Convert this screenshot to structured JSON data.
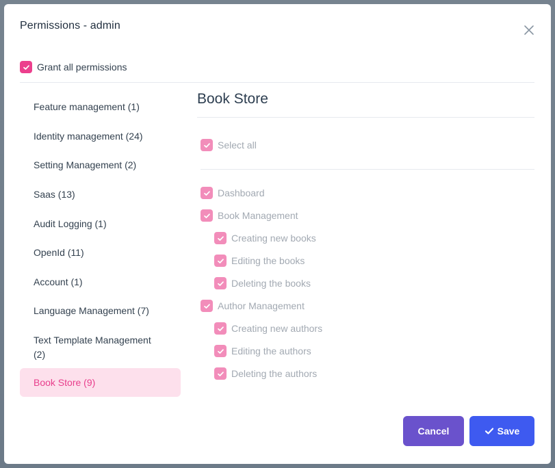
{
  "modal": {
    "title": "Permissions - admin"
  },
  "grant_all": {
    "label": "Grant all permissions",
    "checked": true
  },
  "sidebar": {
    "items": [
      {
        "label": "Feature management (1)"
      },
      {
        "label": "Identity management (24)"
      },
      {
        "label": "Setting Management (2)"
      },
      {
        "label": "Saas (13)"
      },
      {
        "label": "Audit Logging (1)"
      },
      {
        "label": "OpenId (11)"
      },
      {
        "label": "Account (1)"
      },
      {
        "label": "Language Management (7)"
      },
      {
        "label": "Text Template Management (2)"
      },
      {
        "label": "Book Store (9)",
        "active": true
      }
    ]
  },
  "panel": {
    "title": "Book Store",
    "select_all": "Select all",
    "permissions": [
      {
        "label": "Dashboard",
        "level": 0,
        "checked": true
      },
      {
        "label": "Book Management",
        "level": 0,
        "checked": true
      },
      {
        "label": "Creating new books",
        "level": 1,
        "checked": true
      },
      {
        "label": "Editing the books",
        "level": 1,
        "checked": true
      },
      {
        "label": "Deleting the books",
        "level": 1,
        "checked": true
      },
      {
        "label": "Author Management",
        "level": 0,
        "checked": true
      },
      {
        "label": "Creating new authors",
        "level": 1,
        "checked": true
      },
      {
        "label": "Editing the authors",
        "level": 1,
        "checked": true
      },
      {
        "label": "Deleting the authors",
        "level": 1,
        "checked": true
      }
    ]
  },
  "footer": {
    "cancel_label": "Cancel",
    "save_label": "Save"
  },
  "colors": {
    "accent_pink": "#ec3f8d",
    "checkbox_disabled": "#f28dba",
    "active_item_bg": "#fde0ec",
    "cancel_bg": "#6a52cc",
    "save_bg": "#3e5af0"
  },
  "icons": {
    "close": "close-icon",
    "check": "check-icon"
  }
}
